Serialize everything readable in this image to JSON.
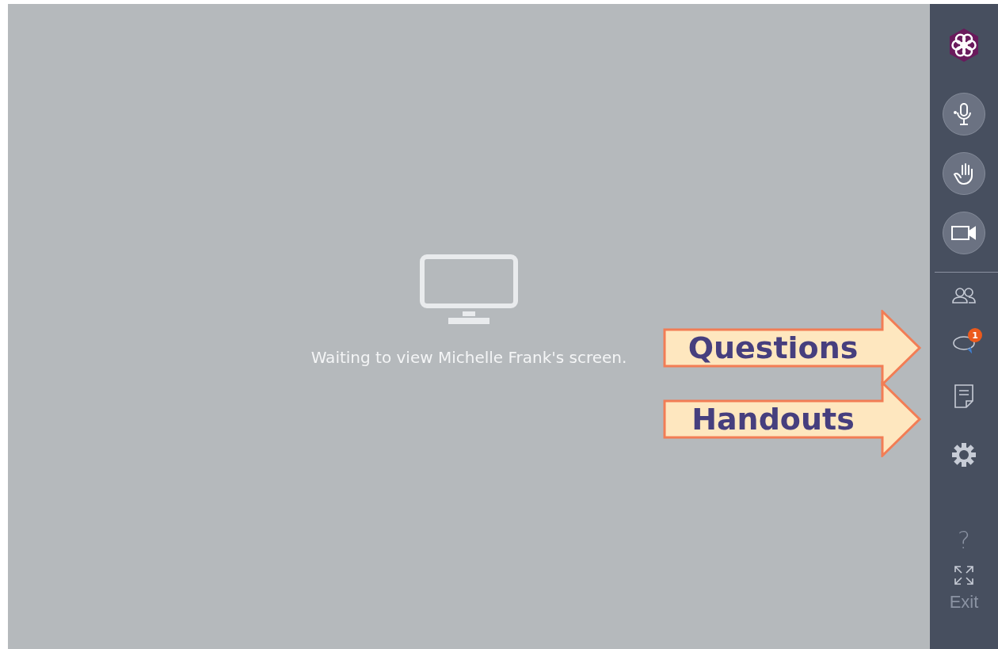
{
  "stage": {
    "message": "Waiting to view Michelle Frank's screen."
  },
  "sidebar": {
    "questions_badge": "1",
    "help": "?",
    "exit": "Exit"
  },
  "callouts": [
    {
      "label": "Questions"
    },
    {
      "label": "Handouts"
    }
  ]
}
